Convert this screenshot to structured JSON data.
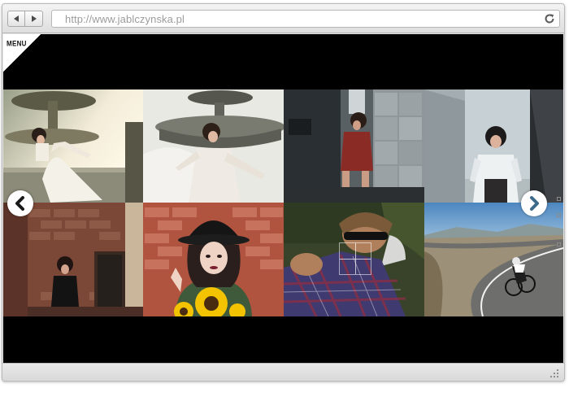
{
  "browser": {
    "back_icon": "chevron-left-icon",
    "forward_icon": "chevron-right-icon",
    "address_url": "http://www.jablczynska.pl",
    "reload_icon": "reload-icon"
  },
  "site": {
    "menu_label": "MENU",
    "prev_icon": "chevron-left-icon",
    "next_icon": "chevron-right-icon"
  },
  "gallery": {
    "photos": [
      {
        "subject": "woman in white dress at fountain",
        "palette": [
          "#e9e4d4",
          "#6d6a58"
        ]
      },
      {
        "subject": "woman in lace dress at fountain",
        "palette": [
          "#e8e8e4",
          "#7d7a6e"
        ]
      },
      {
        "subject": "woman in red dress in corridor",
        "palette": [
          "#4a5258",
          "#8a2d28"
        ]
      },
      {
        "subject": "woman in white top by wall",
        "palette": [
          "#c9d2d6",
          "#2a2d30"
        ]
      },
      {
        "subject": "woman in black by brick wall",
        "palette": [
          "#7d4a38",
          "#141414"
        ]
      },
      {
        "subject": "woman in hat with sunflowers",
        "palette": [
          "#b5533e",
          "#f2c400"
        ]
      },
      {
        "subject": "man in plaid shirt lying on grass",
        "palette": [
          "#3f4a2c",
          "#5b3f8a"
        ]
      },
      {
        "subject": "cyclist on mountain road",
        "palette": [
          "#5d95c9",
          "#6b6b66"
        ]
      }
    ]
  },
  "colors": {
    "viewport_bg": "#000000",
    "chrome_bg": "#e6e6e6",
    "url_text": "#9c9c9c"
  }
}
